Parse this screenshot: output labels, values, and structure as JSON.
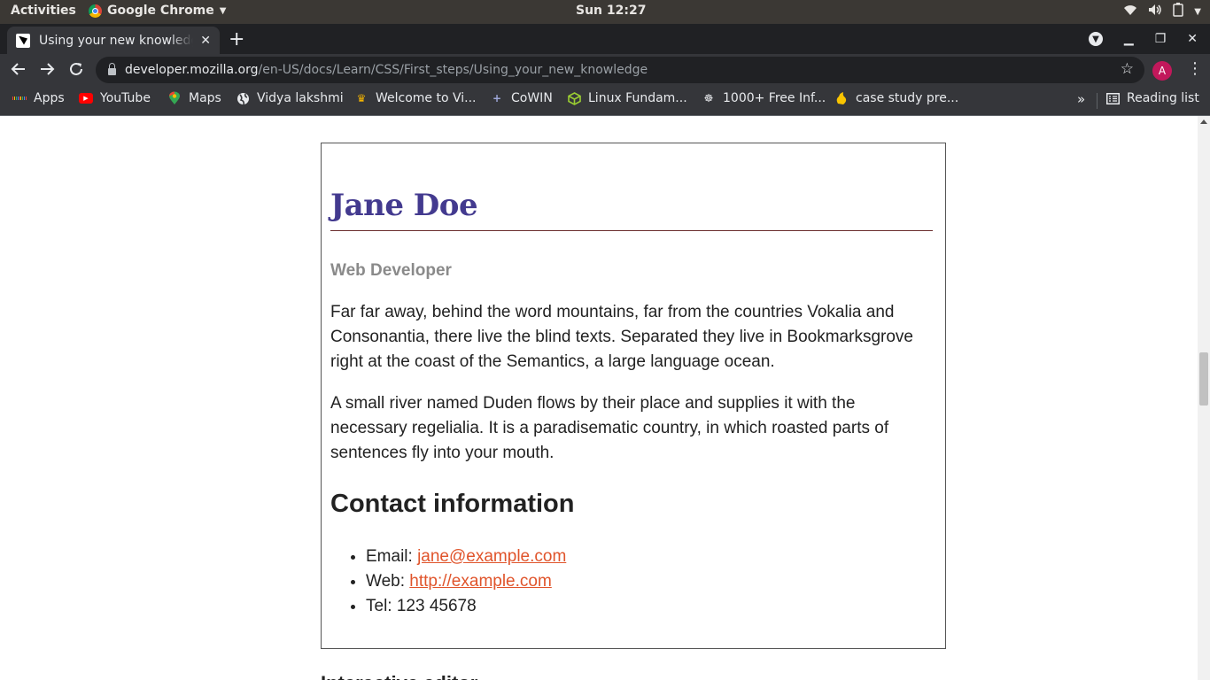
{
  "os_bar": {
    "activities": "Activities",
    "app_name": "Google Chrome",
    "clock": "Sun 12:27"
  },
  "browser": {
    "tab_title": "Using your new knowledge - Learn web development | MDN",
    "url_host": "developer.mozilla.org",
    "url_path": "/en-US/docs/Learn/CSS/First_steps/Using_your_new_knowledge",
    "profile_initial": "A",
    "bookmarks": [
      {
        "label": "Apps",
        "icon": "apps-grid-icon"
      },
      {
        "label": "YouTube",
        "icon": "youtube-icon"
      },
      {
        "label": "Maps",
        "icon": "maps-icon"
      },
      {
        "label": "Vidya lakshmi",
        "icon": "globe-icon"
      },
      {
        "label": "Welcome to Vi...",
        "icon": "site-icon"
      },
      {
        "label": "CoWIN",
        "icon": "plus-icon"
      },
      {
        "label": "Linux Fundam...",
        "icon": "cube-icon"
      },
      {
        "label": "1000+ Free Inf...",
        "icon": "site-icon"
      },
      {
        "label": "case study pre...",
        "icon": "site-icon"
      }
    ],
    "bookmarks_overflow": "»",
    "reading_list": "Reading list"
  },
  "page": {
    "name": "Jane Doe",
    "role": "Web Developer",
    "paragraphs": [
      "Far far away, behind the word mountains, far from the countries Vokalia and Consonantia, there live the blind texts. Separated they live in Bookmarksgrove right at the coast of the Semantics, a large language ocean.",
      "A small river named Duden flows by their place and supplies it with the necessary regelialia. It is a paradisematic country, in which roasted parts of sentences fly into your mouth."
    ],
    "contact_heading": "Contact information",
    "contact": {
      "email_label": "Email: ",
      "email": "jane@example.com",
      "web_label": "Web: ",
      "web": "http://example.com",
      "tel": "Tel: 123 45678"
    },
    "next_heading": "Interactive editor"
  },
  "colors": {
    "heading": "#433a8f",
    "link": "#e0542b",
    "rule": "#6b2e2e"
  }
}
